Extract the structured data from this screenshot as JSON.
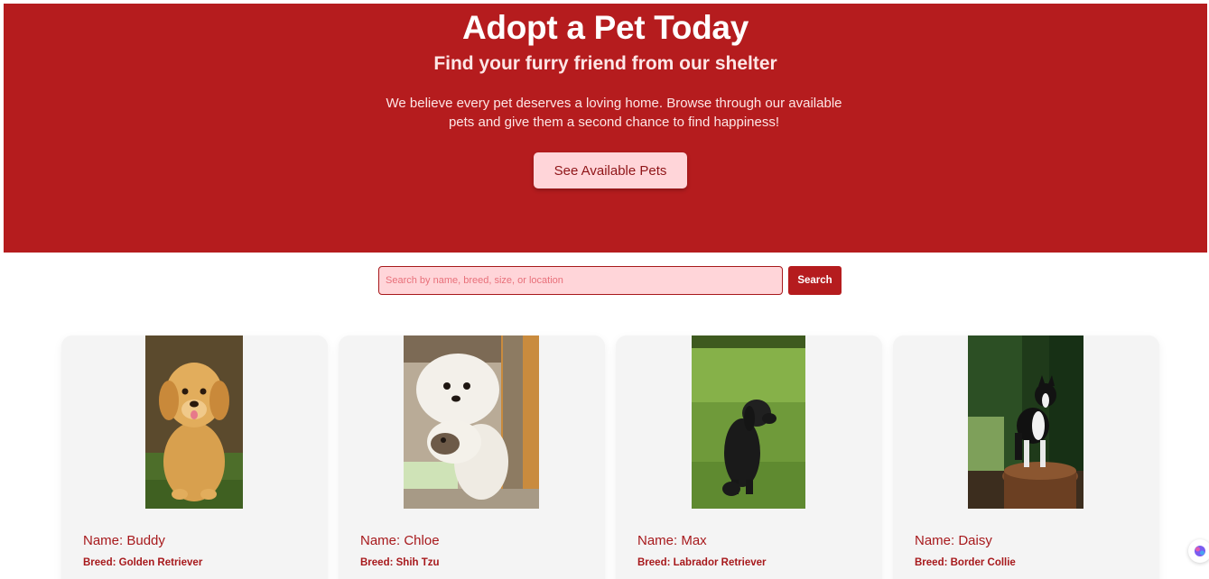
{
  "hero": {
    "title": "Adopt a Pet Today",
    "subtitle": "Find your furry friend from our shelter",
    "description": "We believe every pet deserves a loving home. Browse through our available pets and give them a second chance to find happiness!",
    "cta_label": "See Available Pets"
  },
  "search": {
    "placeholder": "Search by name, breed, size, or location",
    "button_label": "Search"
  },
  "pets": [
    {
      "name": "Name: Buddy",
      "breed": "Breed: Golden Retriever"
    },
    {
      "name": "Name: Chloe",
      "breed": "Breed: Shih Tzu"
    },
    {
      "name": "Name: Max",
      "breed": "Breed: Labrador Retriever"
    },
    {
      "name": "Name: Daisy",
      "breed": "Breed: Border Collie"
    }
  ],
  "colors": {
    "primary": "#b51c1e",
    "accent_light": "#ffd5d9",
    "card_bg": "#f4f4f4"
  },
  "icons": {
    "corner_assistant": "assistant-icon"
  }
}
